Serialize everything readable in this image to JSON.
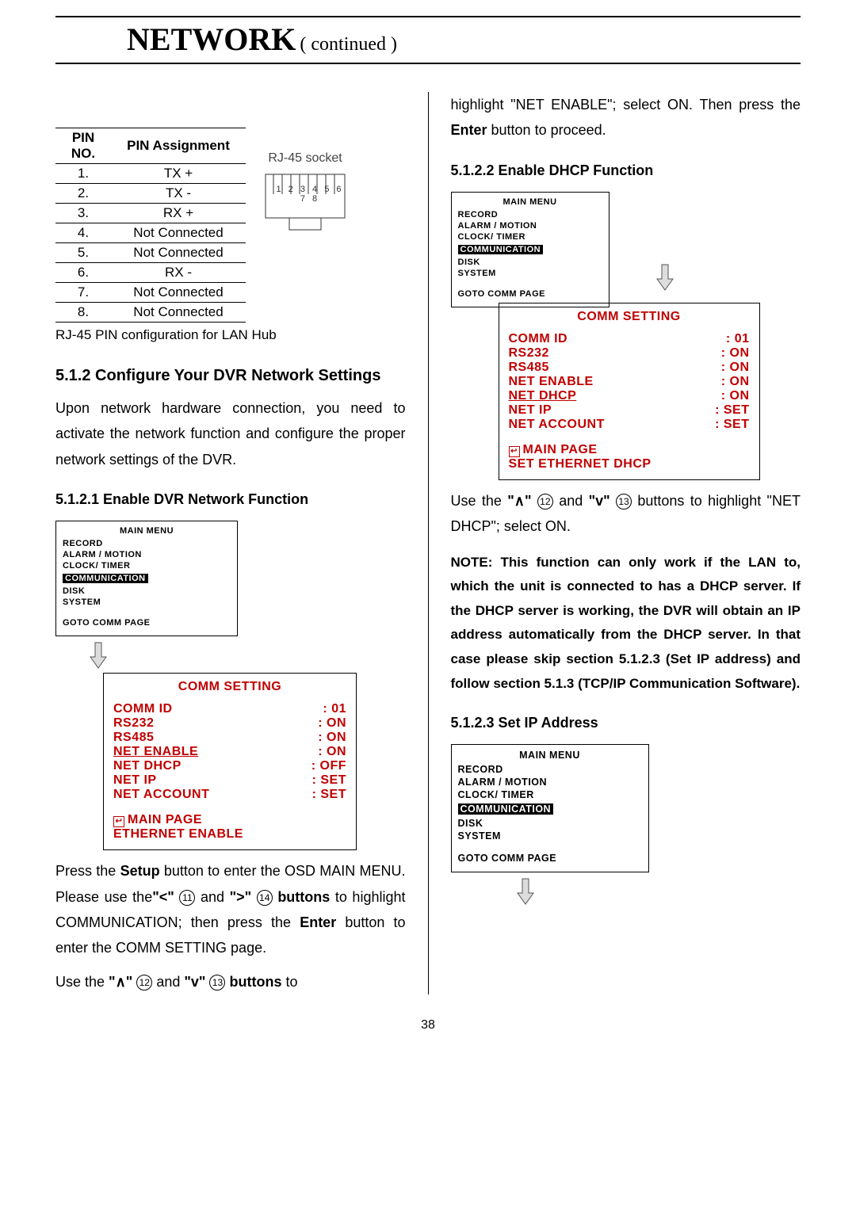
{
  "header": {
    "title": "NETWORK",
    "continued": "( continued )"
  },
  "pin_table": {
    "headers": [
      "PIN NO.",
      "PIN Assignment"
    ],
    "rows": [
      [
        "1.",
        "TX +"
      ],
      [
        "2.",
        "TX -"
      ],
      [
        "3.",
        "RX +"
      ],
      [
        "4.",
        "Not Connected"
      ],
      [
        "5.",
        "Not Connected"
      ],
      [
        "6.",
        "RX -"
      ],
      [
        "7.",
        "Not Connected"
      ],
      [
        "8.",
        "Not Connected"
      ]
    ],
    "caption": "RJ-45 PIN configuration for LAN Hub",
    "socket_label": "RJ-45 socket",
    "socket_digits": "1 2 3 4 5 6 7 8"
  },
  "sections": {
    "s512": {
      "title": "5.1.2 Configure Your DVR Network Settings",
      "para": "Upon network hardware connection, you need to activate the network function and configure the proper network settings of the DVR."
    },
    "s5121": {
      "title": "5.1.2.1 Enable DVR Network Function",
      "text_before": "Press the ",
      "b_setup": "Setup",
      "text_after_setup": " button to enter the OSD MAIN MENU. Please use the",
      "lt": "\"<\"",
      "btn11": "11",
      "and1": " and ",
      "gt": "\">\"",
      "btn14": "14",
      "buttons_to": " buttons",
      "rest1": " to highlight COMMUNICATION; then press the ",
      "b_enter": "Enter",
      "rest2": " button to enter the COMM SETTING page.",
      "line2_a": "Use the ",
      "up": "\"∧\"",
      "btn12": "12",
      "and2": " and ",
      "dn": "\"v\"",
      "btn13": "13",
      "buttons_to_2": " buttons",
      "line2_b": " to"
    },
    "right_intro": {
      "l1": "highlight \"NET ENABLE\"; select ON. Then press the ",
      "b_enter": "Enter",
      "l2": " button to proceed."
    },
    "s5122": {
      "title": "5.1.2.2 Enable DHCP Function",
      "after_a": "Use the ",
      "up": "\"∧\"",
      "btn12": "12",
      "and": " and ",
      "dn": "\"v\"",
      "btn13": "13",
      "after_b": " buttons to highlight \"NET DHCP\"; select ON."
    },
    "note_dhcp": "NOTE: This function can only work if the LAN to, which the unit is connected to has a DHCP server. If the DHCP server is working, the DVR will obtain an IP address automatically from the DHCP server. In that case please skip section 5.1.2.3 (Set IP address) and follow section 5.1.3 (TCP/IP Communication Software).",
    "s5123": {
      "title": "5.1.2.3 Set IP Address"
    }
  },
  "main_menu": {
    "title": "MAIN  MENU",
    "items": [
      "RECORD",
      "ALARM / MOTION",
      "CLOCK/ TIMER",
      "COMMUNICATION",
      "DISK",
      "SYSTEM"
    ],
    "goto": "GOTO COMM PAGE"
  },
  "comm_setting": {
    "title": "COMM SETTING",
    "rows": [
      {
        "k": "COMM   ID",
        "v": ": 01",
        "u": false
      },
      {
        "k": "RS232",
        "v": ": ON",
        "u": false
      },
      {
        "k": "RS485",
        "v": ": ON",
        "u": false
      },
      {
        "k": "NET ENABLE",
        "v": ": ON",
        "u": true
      },
      {
        "k": "NET DHCP",
        "v": ": OFF",
        "u": false
      },
      {
        "k": "NET IP",
        "v": ": SET",
        "u": false
      },
      {
        "k": "NET ACCOUNT",
        "v": ": SET",
        "u": false
      }
    ],
    "footer_mp": "MAIN PAGE",
    "footer_line": "ETHERNET   ENABLE"
  },
  "comm_setting_dhcp": {
    "title": "COMM SETTING",
    "rows": [
      {
        "k": "COMM   ID",
        "v": ": 01",
        "u": false
      },
      {
        "k": "RS232",
        "v": ": ON",
        "u": false
      },
      {
        "k": "RS485",
        "v": ": ON",
        "u": false
      },
      {
        "k": "NET ENABLE",
        "v": ": ON",
        "u": false
      },
      {
        "k": "NET DHCP",
        "v": ": ON",
        "u": true
      },
      {
        "k": "NET IP",
        "v": ": SET",
        "u": false
      },
      {
        "k": "NET ACCOUNT",
        "v": ": SET",
        "u": false
      }
    ],
    "footer_mp": "MAIN PAGE",
    "footer_line": "SET ETHERNET DHCP"
  },
  "page_number": "38"
}
